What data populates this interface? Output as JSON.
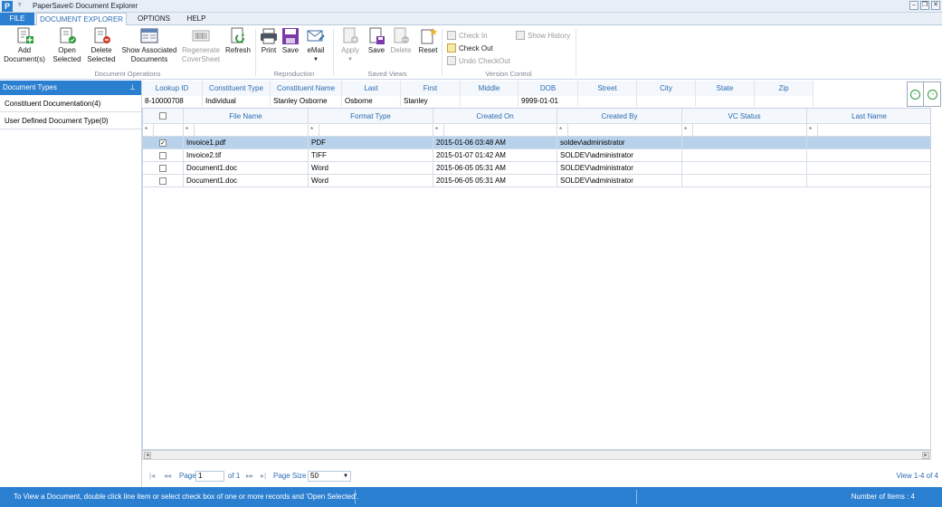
{
  "window": {
    "title": "PaperSave© Document Explorer",
    "app_icon": "P"
  },
  "ribbon_tabs": [
    {
      "label": "FILE"
    },
    {
      "label": "DOCUMENT EXPLORER"
    },
    {
      "label": "OPTIONS"
    },
    {
      "label": "HELP"
    }
  ],
  "ribbon": {
    "doc_ops": {
      "add": "Add Document(s)",
      "open": "Open Selected",
      "delete": "Delete Selected",
      "show_assoc": "Show Associated Documents",
      "regenerate": "Regenerate CoverSheet",
      "refresh": "Refresh",
      "group": "Document Operations"
    },
    "reproduction": {
      "print": "Print",
      "save": "Save",
      "email": "eMail",
      "group": "Reproduction"
    },
    "saved_views": {
      "apply": "Apply",
      "save": "Save",
      "delete": "Delete",
      "reset": "Reset",
      "group": "Saved Views"
    },
    "version_control": {
      "check_in": "Check In",
      "check_out": "Check Out",
      "undo": "Undo CheckOut",
      "history": "Show History",
      "group": "Version Control"
    }
  },
  "left_panel": {
    "title": "Document Types",
    "items": [
      "Constituent Documentation(4)",
      "User Defined Document Type(0)"
    ]
  },
  "constituent": {
    "headers": [
      "Lookup ID",
      "Constituent Type",
      "Constituent Name",
      "Last",
      "First",
      "Middle",
      "DOB",
      "Street",
      "City",
      "State",
      "Zip"
    ],
    "values": [
      "8-10000708",
      "Individual",
      "Stanley Osborne",
      "Osborne",
      "Stanley",
      "",
      "9999-01-01",
      "",
      "",
      "",
      ""
    ]
  },
  "grid": {
    "columns": [
      "File Name",
      "Format Type",
      "Created On",
      "Created By",
      "VC Status",
      "Last Name"
    ],
    "filter_symbol": "*",
    "rows": [
      {
        "checked": true,
        "cells": [
          "Invoice1.pdf",
          "PDF",
          "2015-01-06 03:48 AM",
          "soldev\\administrator",
          "",
          ""
        ]
      },
      {
        "checked": false,
        "cells": [
          "Invoice2.tif",
          "TIFF",
          "2015-01-07 01:42 AM",
          "SOLDEV\\administrator",
          "",
          ""
        ]
      },
      {
        "checked": false,
        "cells": [
          "Document1.doc",
          "Word",
          "2015-06-05 05:31 AM",
          "SOLDEV\\administrator",
          "",
          ""
        ]
      },
      {
        "checked": false,
        "cells": [
          "Document1.doc",
          "Word",
          "2015-06-05 05:31 AM",
          "SOLDEV\\administrator",
          "",
          ""
        ]
      }
    ]
  },
  "pager": {
    "page_label": "Page",
    "page_value": "1",
    "of_label": "of 1",
    "size_label": "Page Size :",
    "size_value": "50",
    "view_text": "View 1-4 of 4"
  },
  "status": {
    "hint": "To View a Document, double click line item or select check box of one or more records and 'Open Selected'.",
    "count": "Number of Items : 4"
  }
}
